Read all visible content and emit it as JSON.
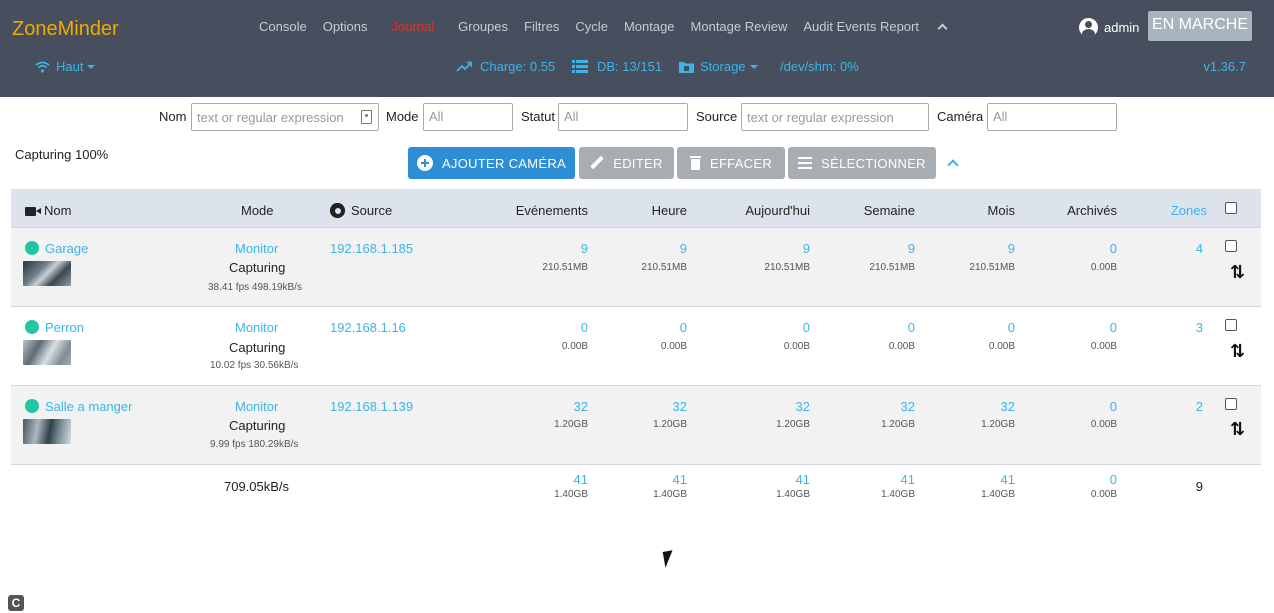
{
  "header": {
    "brand": "ZoneMinder",
    "nav": [
      "Console",
      "Options",
      "Journal",
      "Groupes",
      "Filtres",
      "Cycle",
      "Montage",
      "Montage Review",
      "Audit Events Report"
    ],
    "active_nav": "Journal",
    "user": "admin",
    "status_button": "EN MARCHE",
    "bandwidth": "Haut",
    "load": "Charge: 0.55",
    "db": "DB: 13/151",
    "storage": "Storage",
    "shm": "/dev/shm: 0%",
    "version": "v1.36.7"
  },
  "filters": {
    "name_label": "Nom",
    "name_placeholder": "text or regular expression",
    "mode_label": "Mode",
    "mode_value": "All",
    "status_label": "Statut",
    "status_value": "All",
    "source_label": "Source",
    "source_placeholder": "text or regular expression",
    "camera_label": "Caméra",
    "camera_value": "All"
  },
  "toolbar": {
    "capturing": "Capturing 100%",
    "add": "AJOUTER CAMÉRA",
    "edit": "EDITER",
    "delete": "EFFACER",
    "select": "SÉLECTIONNER"
  },
  "table": {
    "headers": {
      "name": "Nom",
      "mode": "Mode",
      "source": "Source",
      "events": "Evénements",
      "hour": "Heure",
      "today": "Aujourd'hui",
      "week": "Semaine",
      "month": "Mois",
      "archived": "Archivés",
      "zones": "Zones"
    },
    "rows": [
      {
        "name": "Garage",
        "function": "Monitor",
        "status": "Capturing",
        "stats": "38.41 fps 498.19kB/s",
        "source": "192.168.1.185",
        "events": "9",
        "events_size": "210.51MB",
        "hour": "9",
        "hour_size": "210.51MB",
        "today": "9",
        "today_size": "210.51MB",
        "week": "9",
        "week_size": "210.51MB",
        "month": "9",
        "month_size": "210.51MB",
        "archived": "0",
        "archived_size": "0.00B",
        "zones": "4"
      },
      {
        "name": "Perron",
        "function": "Monitor",
        "status": "Capturing",
        "stats": "10.02 fps 30.56kB/s",
        "source": "192.168.1.16",
        "events": "0",
        "events_size": "0.00B",
        "hour": "0",
        "hour_size": "0.00B",
        "today": "0",
        "today_size": "0.00B",
        "week": "0",
        "week_size": "0.00B",
        "month": "0",
        "month_size": "0.00B",
        "archived": "0",
        "archived_size": "0.00B",
        "zones": "3"
      },
      {
        "name": "Salle a manger",
        "function": "Monitor",
        "status": "Capturing",
        "stats": "9.99 fps 180.29kB/s",
        "source": "192.168.1.139",
        "events": "32",
        "events_size": "1.20GB",
        "hour": "32",
        "hour_size": "1.20GB",
        "today": "32",
        "today_size": "1.20GB",
        "week": "32",
        "week_size": "1.20GB",
        "month": "32",
        "month_size": "1.20GB",
        "archived": "0",
        "archived_size": "0.00B",
        "zones": "2"
      }
    ],
    "totals": {
      "bandwidth": "709.05kB/s",
      "events": "41",
      "events_size": "1.40GB",
      "hour": "41",
      "hour_size": "1.40GB",
      "today": "41",
      "today_size": "1.40GB",
      "week": "41",
      "week_size": "1.40GB",
      "month": "41",
      "month_size": "1.40GB",
      "archived": "0",
      "archived_size": "0.00B",
      "zones": "9"
    }
  },
  "corner_badge": "C"
}
